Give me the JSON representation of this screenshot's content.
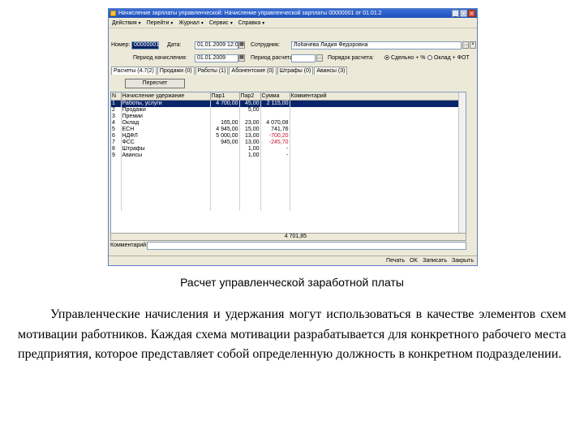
{
  "window": {
    "title": "Начисление зарплаты управленческой: Начисление управленческой зарплаты 00000001 от 01.01.2",
    "menu": [
      "Действия",
      "Перейти",
      "Журнал",
      "Сервис",
      "Справка"
    ],
    "fields": {
      "number_label": "Номер:",
      "number_value": "00000001",
      "date_label": "Дата:",
      "date_value": "01.01.2009 12:00:00",
      "employee_label": "Сотрудник:",
      "employee_value": "Лобачева Лидия Федоровна",
      "period_label": "Период начисления:",
      "period_value": "01.01.2009",
      "calc_period_label": "Период расчета:",
      "payment_method_label": "Порядок расчета:",
      "payment_options": [
        "Сдельно + %",
        "Оклад + ФОТ"
      ]
    },
    "tabs": [
      "Расчеты (4.7(2)",
      "Продажи (0)",
      "Работы (1)",
      "Абонентские (0)",
      "Штрафы (0)",
      "Авансы (3)"
    ],
    "recalc_button": "Пересчет",
    "table": {
      "headers": [
        "N",
        "Начисление удержание",
        "Пар1",
        "Пар2",
        "Сумма",
        "Комментарий"
      ],
      "rows": [
        {
          "n": "1",
          "name": "Работы, услуги",
          "p1": "4 700,00",
          "p2": "45,00",
          "sum": "2 115,00",
          "red": false
        },
        {
          "n": "2",
          "name": "Продажи",
          "p1": "",
          "p2": "5,00",
          "sum": "",
          "red": false
        },
        {
          "n": "3",
          "name": "Премии",
          "p1": "",
          "p2": "",
          "sum": "",
          "red": false
        },
        {
          "n": "4",
          "name": "Оклад",
          "p1": "165,00",
          "p2": "23,00",
          "sum": "4 070,08",
          "red": false
        },
        {
          "n": "5",
          "name": "ЕСН",
          "p1": "4 945,00",
          "p2": "15,00",
          "sum": "741,76",
          "red": false
        },
        {
          "n": "6",
          "name": "НДФЛ",
          "p1": "5 000,00",
          "p2": "13,00",
          "sum": "-700,20",
          "red": true
        },
        {
          "n": "7",
          "name": "ФСС",
          "p1": "945,00",
          "p2": "13,00",
          "sum": "-245,70",
          "red": true
        },
        {
          "n": "8",
          "name": "Штрафы",
          "p1": "",
          "p2": "1,00",
          "sum": "-",
          "red": false
        },
        {
          "n": "9",
          "name": "Авансы",
          "p1": "",
          "p2": "1,00",
          "sum": "-",
          "red": false
        }
      ],
      "total": "4 701,85"
    },
    "comment_label": "Комментарий:",
    "bottom_buttons": [
      "Печать",
      "OK",
      "Записать",
      "Закрыть"
    ]
  },
  "caption": "Расчет управленческой заработной платы",
  "paragraph": "Управленческие начисления и удержания могут использоваться в качестве элементов схем мотивации работников. Каждая схема мотивации разрабатывается для конкретного рабочего места предприятия, которое представляет собой определенную должность в конкретном подразделении."
}
